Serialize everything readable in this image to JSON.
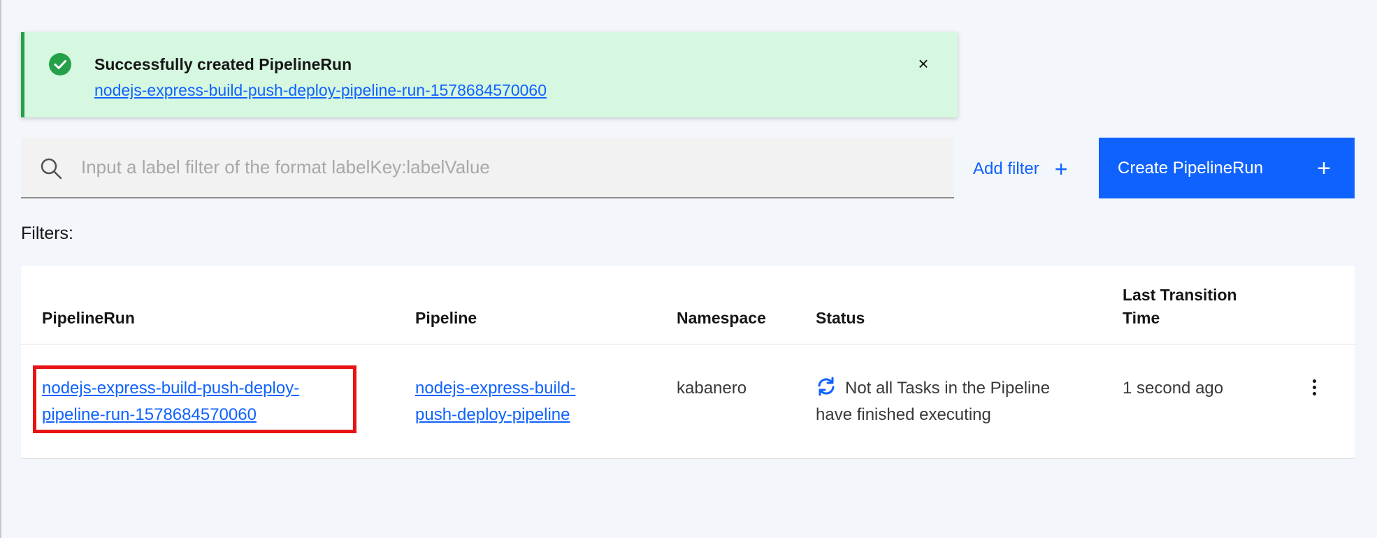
{
  "notification": {
    "title": "Successfully created PipelineRun",
    "link_text": "nodejs-express-build-push-deploy-pipeline-run-1578684570060",
    "close_symbol": "×",
    "icon": "checkmark-filled-icon",
    "accent_color": "#24a148"
  },
  "toolbar": {
    "search_placeholder": "Input a label filter of the format labelKey:labelValue",
    "search_value": "",
    "add_filter_label": "Add filter",
    "add_filter_symbol": "+",
    "create_label": "Create PipelineRun",
    "create_symbol": "+",
    "accent_color": "#0f62fe"
  },
  "filters": {
    "label": "Filters:"
  },
  "table": {
    "headers": {
      "pipelinerun": "PipelineRun",
      "pipeline": "Pipeline",
      "namespace": "Namespace",
      "status": "Status",
      "last_transition_line1": "Last Transition",
      "last_transition_line2": "Time"
    },
    "rows": [
      {
        "pipelinerun_line1": "nodejs-express-build-push-deploy-",
        "pipelinerun_line2": "pipeline-run-1578684570060",
        "pipeline_line1": "nodejs-express-build-",
        "pipeline_line2": "push-deploy-pipeline",
        "namespace": "kabanero",
        "status_icon": "refresh-running-icon",
        "status_line1": "Not all Tasks in the Pipeline",
        "status_line2": "have finished executing",
        "last_transition": "1 second ago"
      }
    ]
  }
}
